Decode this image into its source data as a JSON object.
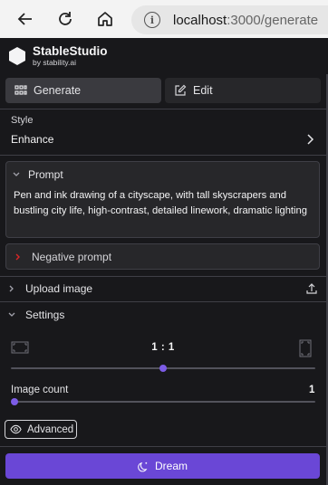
{
  "browser": {
    "address_host": "localhost",
    "address_rest": ":3000/generate"
  },
  "app": {
    "title": "StableStudio",
    "subtitle": "by stability.ai"
  },
  "tabs": [
    {
      "label": "Generate",
      "icon": "grid-icon",
      "active": true
    },
    {
      "label": "Edit",
      "icon": "edit-icon",
      "active": false
    }
  ],
  "style": {
    "label": "Style",
    "value": "Enhance"
  },
  "prompt": {
    "label": "Prompt",
    "text": "Pen and ink drawing of a cityscape, with tall skyscrapers and bustling city life, high-contrast, detailed linework, dramatic lighting"
  },
  "negative_prompt": {
    "label": "Negative prompt"
  },
  "upload": {
    "label": "Upload image"
  },
  "settings": {
    "label": "Settings",
    "aspect_ratio": "1 : 1",
    "aspect_level": 0.5,
    "image_count_label": "Image count",
    "image_count": "1",
    "image_count_level": 0.0
  },
  "advanced": {
    "label": "Advanced"
  },
  "dream": {
    "label": "Dream"
  },
  "colors": {
    "accent": "#6a47d6",
    "slider_thumb": "#7c5ce6",
    "background": "#18181b",
    "panel": "#27272a"
  }
}
